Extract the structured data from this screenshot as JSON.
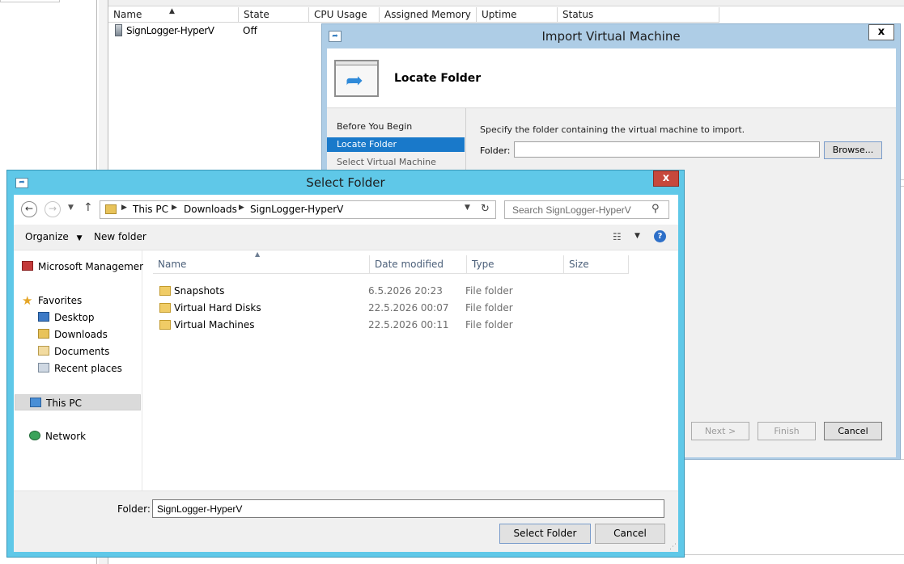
{
  "vm_list": {
    "columns": [
      "Name",
      "State",
      "CPU Usage",
      "Assigned Memory",
      "Uptime",
      "Status"
    ],
    "rows": [
      {
        "name": "SignLogger-HyperV",
        "state": "Off"
      }
    ]
  },
  "import_wizard": {
    "title": "Import Virtual Machine",
    "close_label": "x",
    "header_title": "Locate Folder",
    "steps": [
      "Before You Begin",
      "Locate Folder",
      "Select Virtual Machine"
    ],
    "active_step": "Locate Folder",
    "description": "Specify the folder containing the virtual machine to import.",
    "folder_label": "Folder:",
    "folder_value": "",
    "browse_label": "Browse...",
    "next_label": "Next >",
    "finish_label": "Finish",
    "cancel_label": "Cancel"
  },
  "select_folder": {
    "title": "Select Folder",
    "close_label": "x",
    "breadcrumb": [
      "This PC",
      "Downloads",
      "SignLogger-HyperV"
    ],
    "search_placeholder": "Search SignLogger-HyperV",
    "organize_label": "Organize",
    "new_folder_label": "New folder",
    "nav_tree": [
      {
        "label": "Microsoft Managemen",
        "icon": "mmc-icon"
      },
      {
        "label": "Favorites",
        "icon": "star-icon"
      },
      {
        "label": "Desktop",
        "icon": "desktop-icon"
      },
      {
        "label": "Downloads",
        "icon": "downloads-icon"
      },
      {
        "label": "Documents",
        "icon": "documents-icon"
      },
      {
        "label": "Recent places",
        "icon": "recent-places-icon"
      },
      {
        "label": "This PC",
        "icon": "computer-icon"
      },
      {
        "label": "Network",
        "icon": "network-icon"
      }
    ],
    "columns": [
      "Name",
      "Date modified",
      "Type",
      "Size"
    ],
    "files": [
      {
        "name": "Snapshots",
        "date": "6.5.2026 20:23",
        "type": "File folder"
      },
      {
        "name": "Virtual Hard Disks",
        "date": "22.5.2026 00:07",
        "type": "File folder"
      },
      {
        "name": "Virtual Machines",
        "date": "22.5.2026 00:11",
        "type": "File folder"
      }
    ],
    "folder_label": "Folder:",
    "folder_value": "SignLogger-HyperV",
    "select_label": "Select Folder",
    "cancel_label": "Cancel"
  },
  "colors": {
    "dialog_frame": "#5fc8e8",
    "wizard_frame": "#aecde6",
    "selection": "#1979ca",
    "close_button": "#c7483c"
  }
}
